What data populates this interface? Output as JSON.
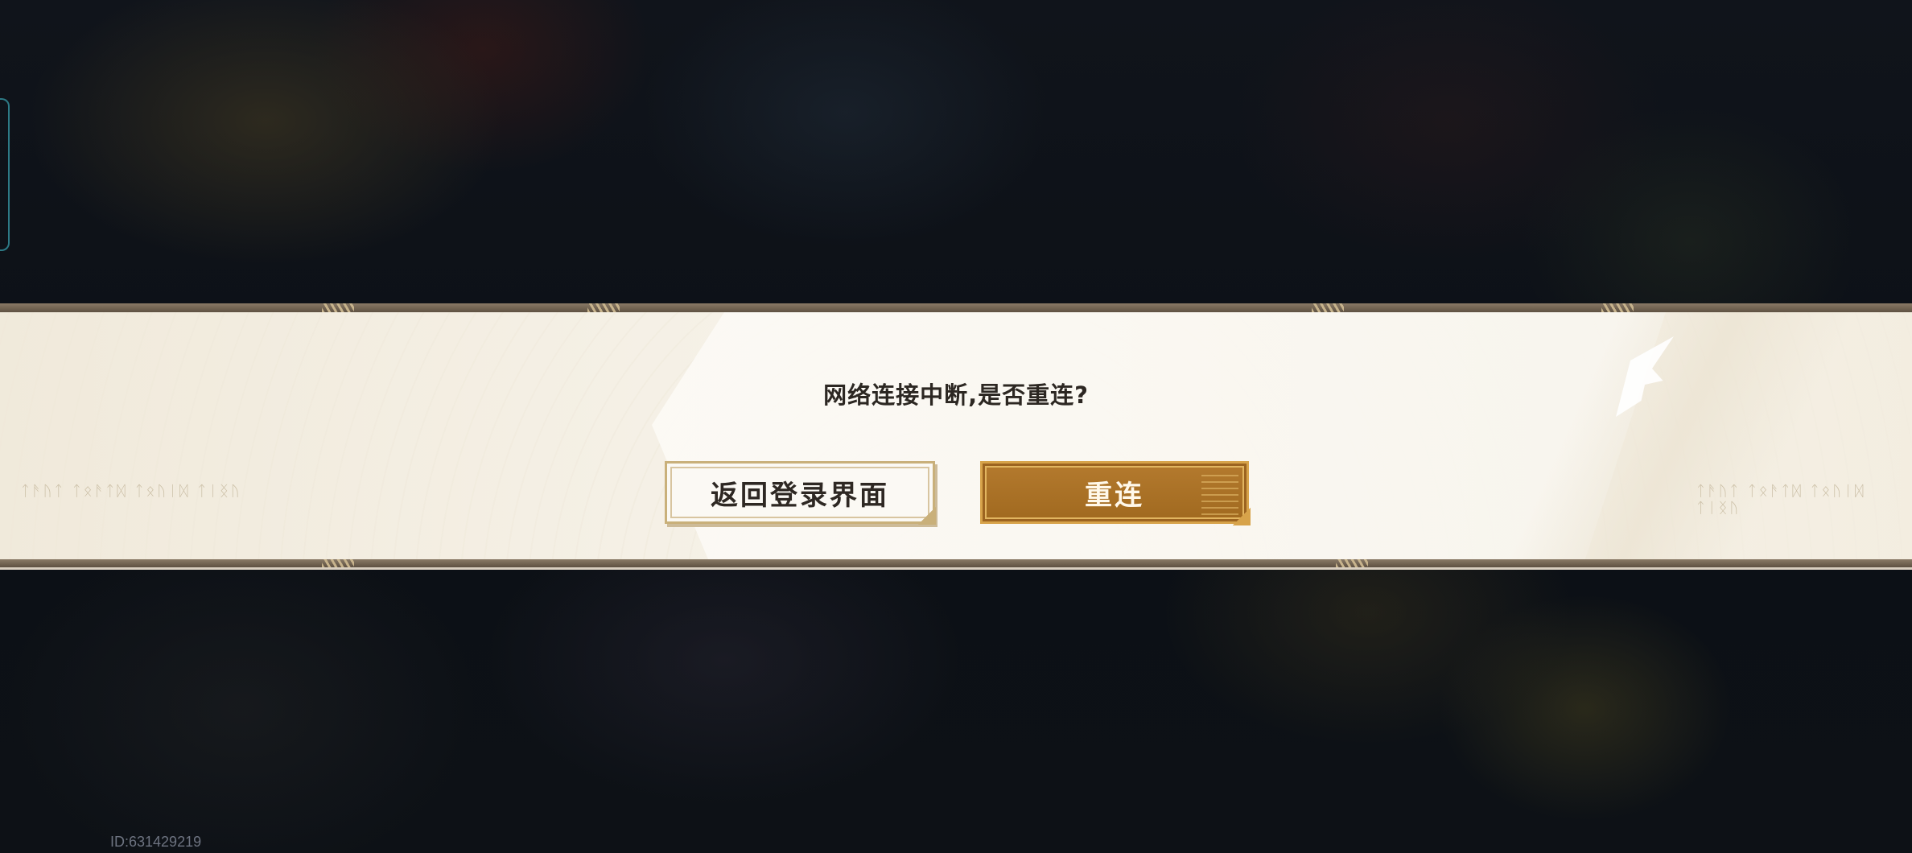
{
  "dialog": {
    "message": "网络连接中断,是否重连?",
    "back_button_label": "返回登录界面",
    "reconnect_button_label": "重连",
    "decorative_text": "ᛏᚫᚢᛏ ᛏᛟᚫᛏᛞ ᛏᛟᚢᛁᛞ ᛏᛁᛝᚢ"
  },
  "footer": {
    "player_id": "ID:631429219"
  },
  "colors": {
    "primary_button": "#a86f25",
    "secondary_button": "#fbf9f4",
    "band": "#f4efe4",
    "text": "#2c2722"
  }
}
